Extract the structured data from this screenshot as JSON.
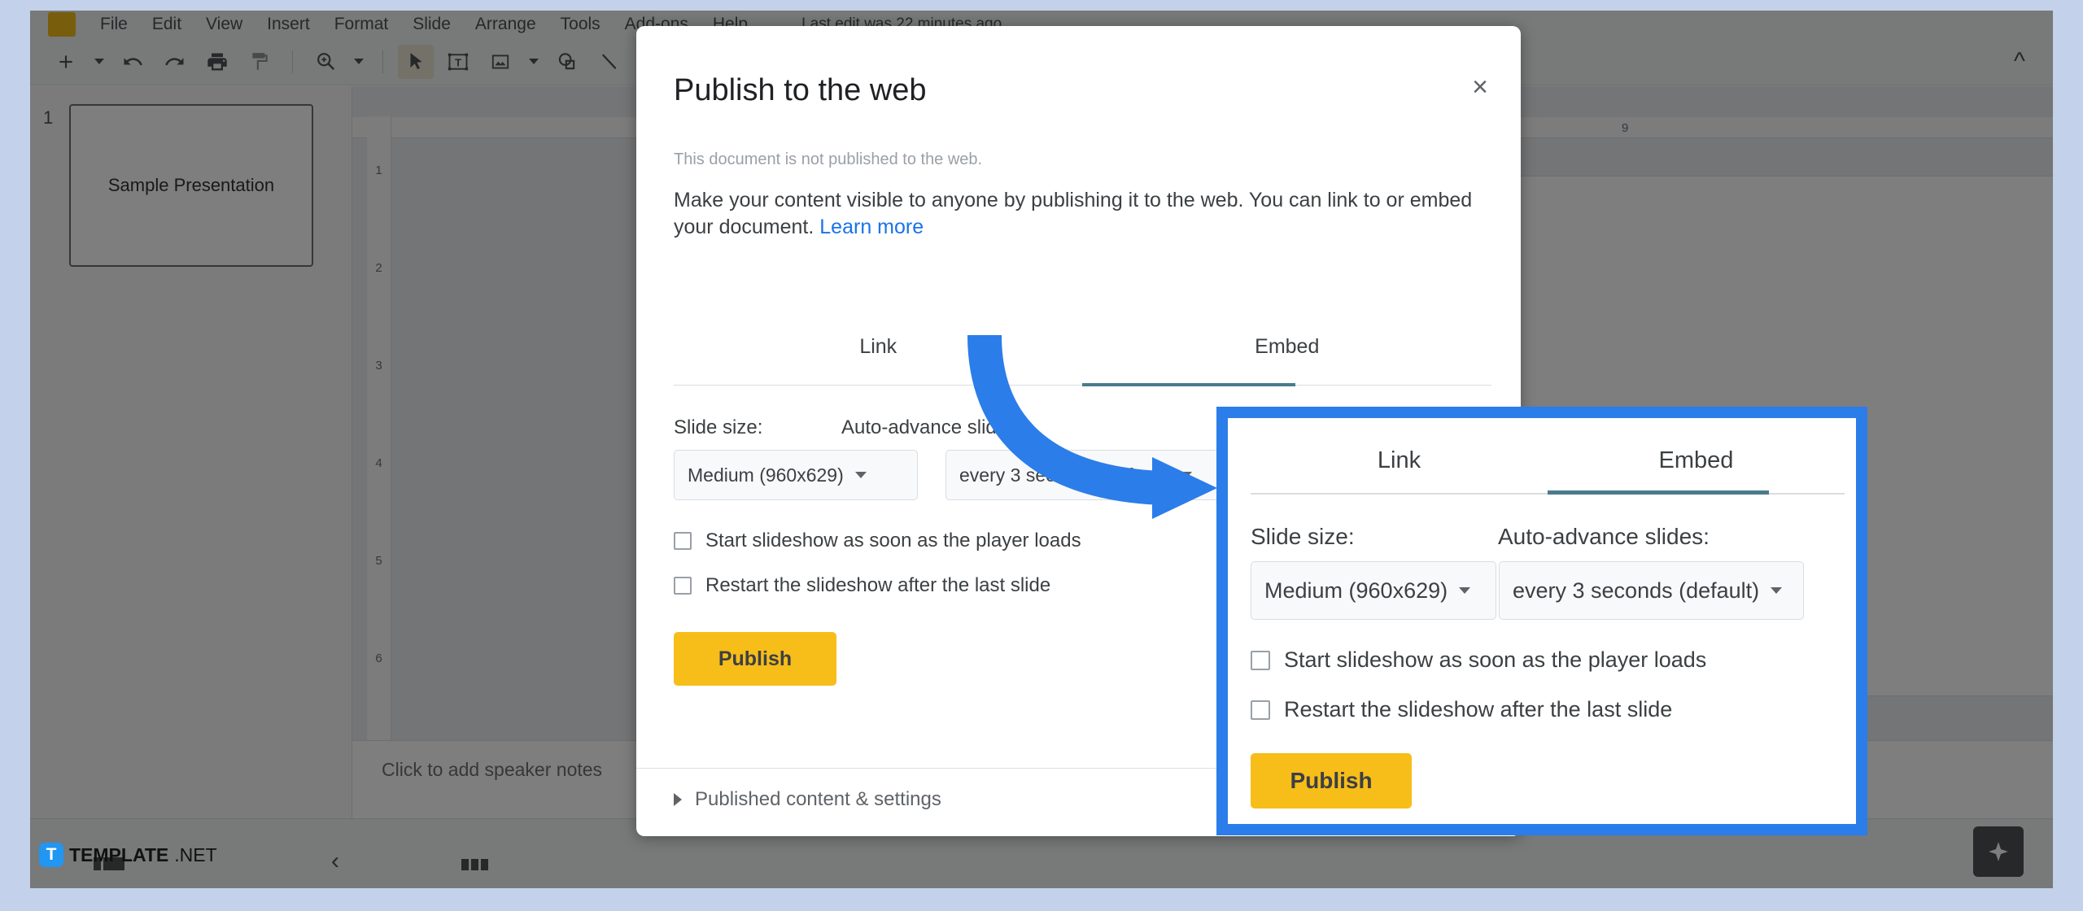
{
  "app": {
    "menu_items": [
      "File",
      "Edit",
      "View",
      "Insert",
      "Format",
      "Slide",
      "Arrange",
      "Tools",
      "Add-ons",
      "Help"
    ],
    "last_edit": "Last edit was 22 minutes ago",
    "toolbar_collapse_icon": "chevron-up-icon",
    "toolbar": [
      {
        "name": "new-slide-button",
        "glyph": "+"
      },
      {
        "name": "new-slide-dropdown",
        "glyph": "caret"
      },
      {
        "name": "undo-button",
        "glyph": "↶"
      },
      {
        "name": "redo-button",
        "glyph": "↷"
      },
      {
        "name": "print-button",
        "glyph": "⎙"
      },
      {
        "name": "paint-format-button",
        "glyph": "὘C"
      },
      {
        "name": "separator",
        "glyph": "sep"
      },
      {
        "name": "zoom-button",
        "glyph": "⌕"
      },
      {
        "name": "zoom-dropdown",
        "glyph": "caret"
      },
      {
        "name": "separator",
        "glyph": "sep"
      },
      {
        "name": "select-tool-button",
        "glyph": "➤"
      },
      {
        "name": "text-box-button",
        "glyph": "T"
      },
      {
        "name": "insert-image-button",
        "glyph": "ὛB"
      },
      {
        "name": "insert-image-dropdown",
        "glyph": "caret"
      },
      {
        "name": "shape-button",
        "glyph": "◯"
      },
      {
        "name": "line-button",
        "glyph": "╲"
      }
    ]
  },
  "filmstrip": {
    "slide_number": "1",
    "slide_title": "Sample Presentation"
  },
  "rulers": {
    "horizontal_marks": [
      "9"
    ],
    "vertical_marks": [
      "1",
      "2",
      "3",
      "4",
      "5",
      "6"
    ]
  },
  "notes": {
    "placeholder": "Click to add speaker notes"
  },
  "status_bar": {
    "explore_icon": "explore-diamond-icon"
  },
  "watermark": {
    "logo_letter": "T",
    "name_bold": "TEMPLATE",
    "name_thin": ".NET"
  },
  "dialog": {
    "title": "Publish to the web",
    "close_icon": "close-icon",
    "status_text": "This document is not published to the web.",
    "description": "Make your content visible to anyone by publishing it to the web. You can link to or embed your document.",
    "learn_more": "Learn more",
    "tabs": [
      {
        "label": "Link",
        "active": false
      },
      {
        "label": "Embed",
        "active": true
      }
    ],
    "slide_size_label": "Slide size:",
    "slide_size_value": "Medium (960x629)",
    "auto_advance_label": "Auto-advance slides:",
    "auto_advance_value": "every 3 seconds (default)",
    "checkbox_start": "Start slideshow as soon as the player loads",
    "checkbox_restart": "Restart the slideshow after the last slide",
    "publish_label": "Publish",
    "settings_label": "Published content & settings"
  },
  "inset": {
    "tabs": [
      {
        "label": "Link",
        "active": false
      },
      {
        "label": "Embed",
        "active": true
      }
    ],
    "slide_size_label": "Slide size:",
    "slide_size_value": "Medium (960x629)",
    "auto_advance_label": "Auto-advance slides:",
    "auto_advance_value": "every 3 seconds (default)",
    "checkbox_start": "Start slideshow as soon as the player loads",
    "checkbox_restart": "Restart the slideshow after the last slide",
    "publish_label": "Publish"
  },
  "colors": {
    "callout_blue": "#2b7de9",
    "publish_yellow": "#f7bd19",
    "tab_active": "#4a7b8c",
    "link_blue": "#1a73e8"
  }
}
